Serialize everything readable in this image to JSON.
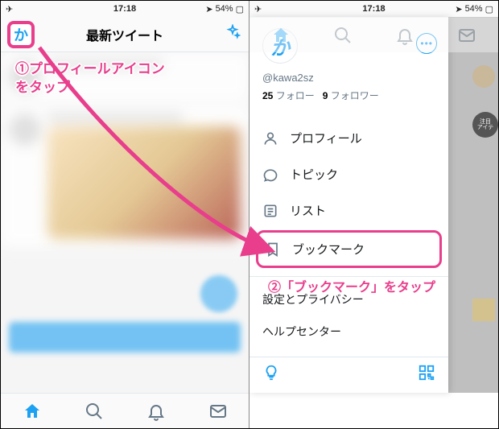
{
  "status": {
    "time": "17:18",
    "battery": "54%"
  },
  "header": {
    "title": "最新ツイート"
  },
  "drawer": {
    "avatar_letter": "か",
    "handle": "@kawa2sz",
    "following_count": "25",
    "following_label": "フォロー",
    "followers_count": "9",
    "followers_label": "フォロワー",
    "items": {
      "profile": "プロフィール",
      "topics": "トピック",
      "lists": "リスト",
      "bookmarks": "ブックマーク"
    },
    "settings": "設定とプライバシー",
    "help": "ヘルプセンター"
  },
  "side_badge": "注目\nアイテ",
  "annotations": {
    "step1": "①プロフィールアイコン\nをタップ",
    "step2": "②「ブックマーク」をタップ"
  }
}
